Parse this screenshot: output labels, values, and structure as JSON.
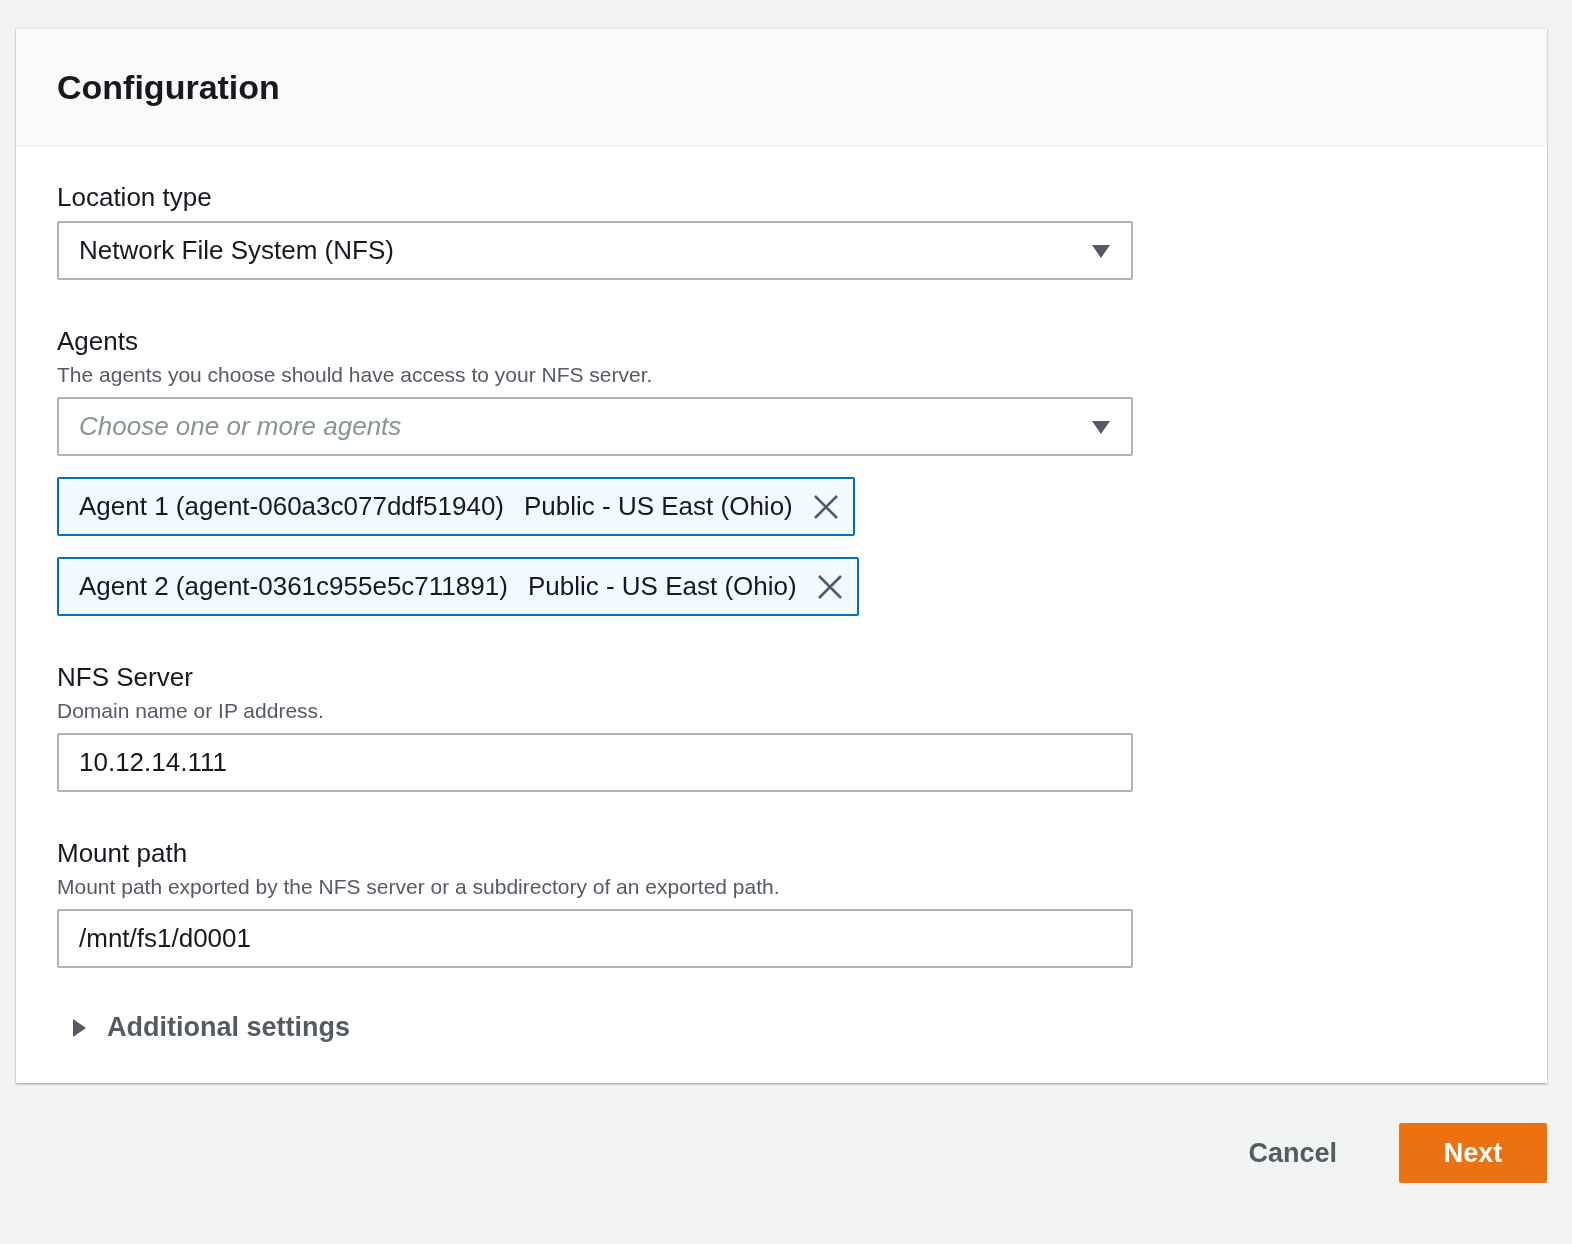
{
  "header": {
    "title": "Configuration"
  },
  "fields": [
    {
      "kind": "select",
      "label": "Location type",
      "value": "Network File System (NFS)"
    },
    {
      "kind": "multiselect",
      "label": "Agents",
      "description": "The agents you choose should have access to your NFS server.",
      "placeholder": "Choose one or more agents",
      "tokens": [
        {
          "name": "Agent 1 (agent-060a3c077ddf51940)",
          "tag": "Public - US East (Ohio)"
        },
        {
          "name": "Agent 2 (agent-0361c955e5c711891)",
          "tag": "Public - US East (Ohio)"
        }
      ]
    },
    {
      "kind": "input",
      "label": "NFS Server",
      "description": "Domain name or IP address.",
      "value": "10.12.14.111"
    },
    {
      "kind": "input",
      "label": "Mount path",
      "description": "Mount path exported by the NFS server or a subdirectory of an exported path.",
      "value": "/mnt/fs1/d0001"
    }
  ],
  "expander": {
    "label": "Additional settings",
    "expanded": false
  },
  "buttons": [
    {
      "kind": "link",
      "label": "Cancel"
    },
    {
      "kind": "primary",
      "label": "Next"
    }
  ]
}
